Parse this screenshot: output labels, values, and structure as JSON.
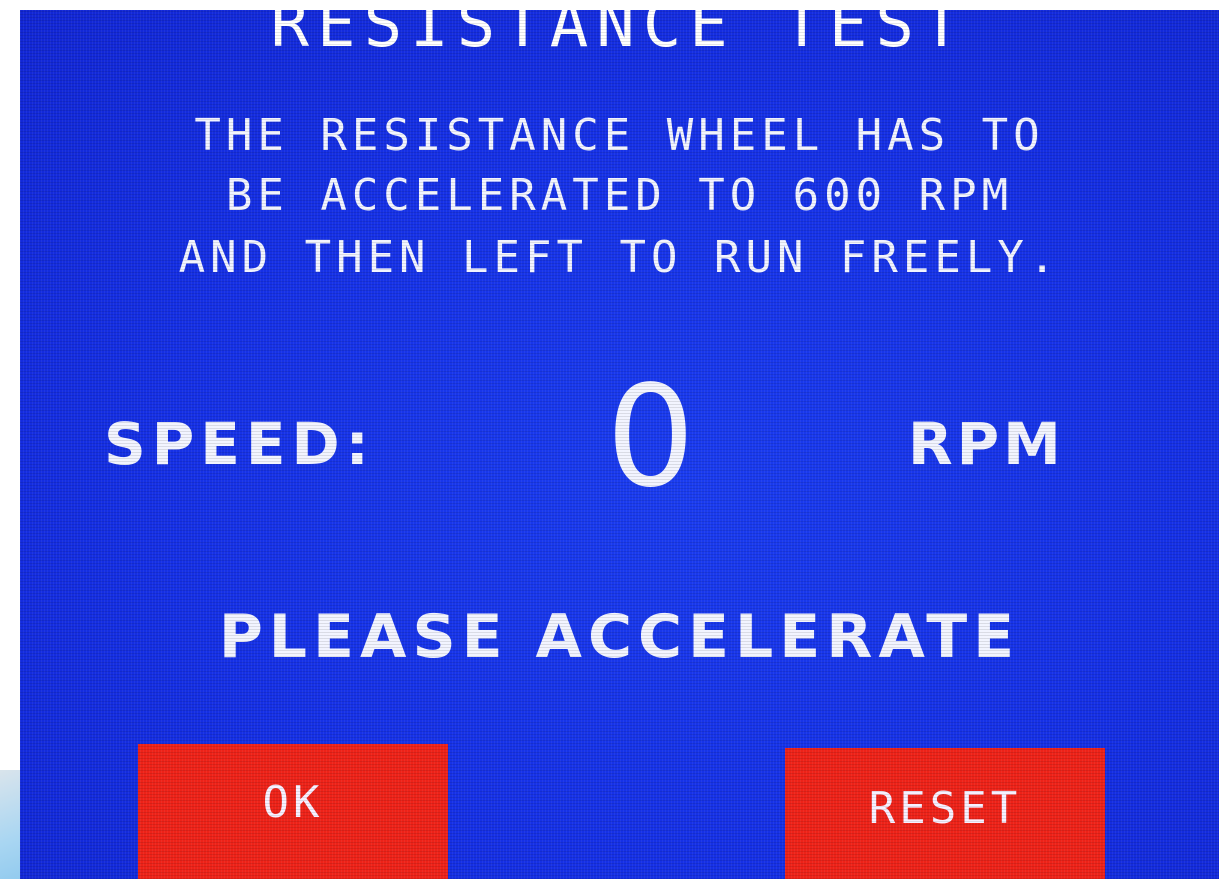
{
  "screen": {
    "title": "RESISTANCE TEST",
    "instructions": [
      "THE RESISTANCE WHEEL HAS TO",
      "BE ACCELERATED TO 600 RPM",
      "AND THEN LEFT TO RUN FREELY."
    ],
    "speed": {
      "label": "SPEED:",
      "value": "0",
      "unit": "RPM"
    },
    "status": "PLEASE ACCELERATE",
    "buttons": {
      "ok_label": "OK",
      "reset_label": "RESET"
    }
  },
  "colors": {
    "screen_background": "#1530e6",
    "text": "#f2f4ff",
    "button_background": "#ee2218"
  }
}
